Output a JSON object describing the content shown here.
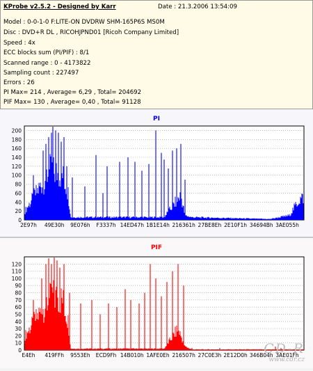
{
  "header": {
    "app_title": "KProbe v2.5.2 - Designed by Karr",
    "date": "Date : 21.3.2006 13:54:09",
    "lines": [
      "Model : 0-0-1-0 F:LITE-ON DVDRW SHM-165P6S MS0M",
      "Disc : DVD+R DL , RICOHJPND01 [Ricoh Company Limited]",
      "Speed : 4x",
      "ECC blocks sum (PI/PIF) : 8/1",
      "Scanned range : 0 - 4173822",
      "Sampling count : 227497",
      "Errors : 26",
      "PI Max= 214 , Average= 6,29 , Total= 204692",
      "PIF Max= 130 , Average= 0,40 , Total= 91128"
    ]
  },
  "watermark": {
    "main": "CD-R",
    "sub": "www.cdr.cz"
  },
  "chart_data": [
    {
      "type": "bar",
      "title": "PI",
      "color": "#0000ff",
      "ylim": [
        0,
        210
      ],
      "yticks": [
        0,
        20,
        40,
        60,
        80,
        100,
        120,
        140,
        160,
        180,
        200
      ],
      "xticks": [
        "2E97h",
        "49E30h",
        "9E076h",
        "F3337h",
        "14ED47h",
        "1B1E14h",
        "216361h",
        "27BE8Eh",
        "2E10F1h",
        "34694Bh",
        "3AE055h"
      ],
      "series": [
        {
          "color": "#0000ff",
          "profile": [
            [
              0,
              20
            ],
            [
              0.04,
              60
            ],
            [
              0.09,
              110
            ],
            [
              0.135,
              100
            ],
            [
              0.155,
              60
            ],
            [
              0.165,
              6
            ],
            [
              0.5,
              6
            ],
            [
              0.56,
              55
            ],
            [
              0.575,
              10
            ],
            [
              0.6,
              6
            ],
            [
              0.88,
              2
            ],
            [
              0.95,
              10
            ],
            [
              0.985,
              45
            ],
            [
              1,
              50
            ]
          ]
        }
      ],
      "spikes": [
        [
          0.03,
          100
        ],
        [
          0.065,
          155
        ],
        [
          0.075,
          170
        ],
        [
          0.085,
          185
        ],
        [
          0.095,
          195
        ],
        [
          0.1,
          210
        ],
        [
          0.11,
          200
        ],
        [
          0.12,
          195
        ],
        [
          0.13,
          175
        ],
        [
          0.14,
          185
        ],
        [
          0.15,
          120
        ],
        [
          0.17,
          95
        ],
        [
          0.215,
          75
        ],
        [
          0.255,
          145
        ],
        [
          0.28,
          60
        ],
        [
          0.295,
          120
        ],
        [
          0.34,
          130
        ],
        [
          0.37,
          140
        ],
        [
          0.395,
          130
        ],
        [
          0.42,
          110
        ],
        [
          0.445,
          125
        ],
        [
          0.47,
          200
        ],
        [
          0.49,
          150
        ],
        [
          0.5,
          135
        ],
        [
          0.515,
          115
        ],
        [
          0.53,
          155
        ],
        [
          0.545,
          160
        ],
        [
          0.56,
          170
        ],
        [
          0.575,
          90
        ]
      ]
    },
    {
      "type": "bar",
      "title": "PIF",
      "color": "#ff0000",
      "ylim": [
        0,
        130
      ],
      "yticks": [
        0,
        10,
        20,
        30,
        40,
        50,
        60,
        70,
        80,
        90,
        100,
        110,
        120
      ],
      "xticks": [
        "E4Eh",
        "419FFh",
        "9553Eh",
        "ECD9Fh",
        "14B010h",
        "1AFE0Eh",
        "216507h",
        "27C0E3h",
        "2E12D0h",
        "346B04h",
        "3AE01Fh"
      ],
      "series": [
        {
          "color": "#ff0000",
          "profile": [
            [
              0,
              20
            ],
            [
              0.05,
              50
            ],
            [
              0.1,
              75
            ],
            [
              0.135,
              70
            ],
            [
              0.155,
              40
            ],
            [
              0.165,
              2
            ],
            [
              0.5,
              2
            ],
            [
              0.55,
              30
            ],
            [
              0.575,
              5
            ],
            [
              0.6,
              1
            ],
            [
              1,
              1
            ]
          ]
        }
      ],
      "spikes": [
        [
          0.03,
          70
        ],
        [
          0.06,
          100
        ],
        [
          0.075,
          120
        ],
        [
          0.085,
          128
        ],
        [
          0.095,
          120
        ],
        [
          0.105,
          130
        ],
        [
          0.115,
          125
        ],
        [
          0.125,
          115
        ],
        [
          0.14,
          120
        ],
        [
          0.16,
          80
        ],
        [
          0.2,
          65
        ],
        [
          0.24,
          70
        ],
        [
          0.27,
          50
        ],
        [
          0.3,
          65
        ],
        [
          0.33,
          60
        ],
        [
          0.36,
          85
        ],
        [
          0.38,
          70
        ],
        [
          0.41,
          65
        ],
        [
          0.43,
          80
        ],
        [
          0.45,
          120
        ],
        [
          0.47,
          100
        ],
        [
          0.49,
          75
        ],
        [
          0.51,
          95
        ],
        [
          0.53,
          110
        ],
        [
          0.55,
          120
        ],
        [
          0.57,
          90
        ],
        [
          0.6,
          3
        ],
        [
          0.7,
          3
        ],
        [
          0.9,
          5
        ],
        [
          0.92,
          3
        ]
      ]
    }
  ]
}
